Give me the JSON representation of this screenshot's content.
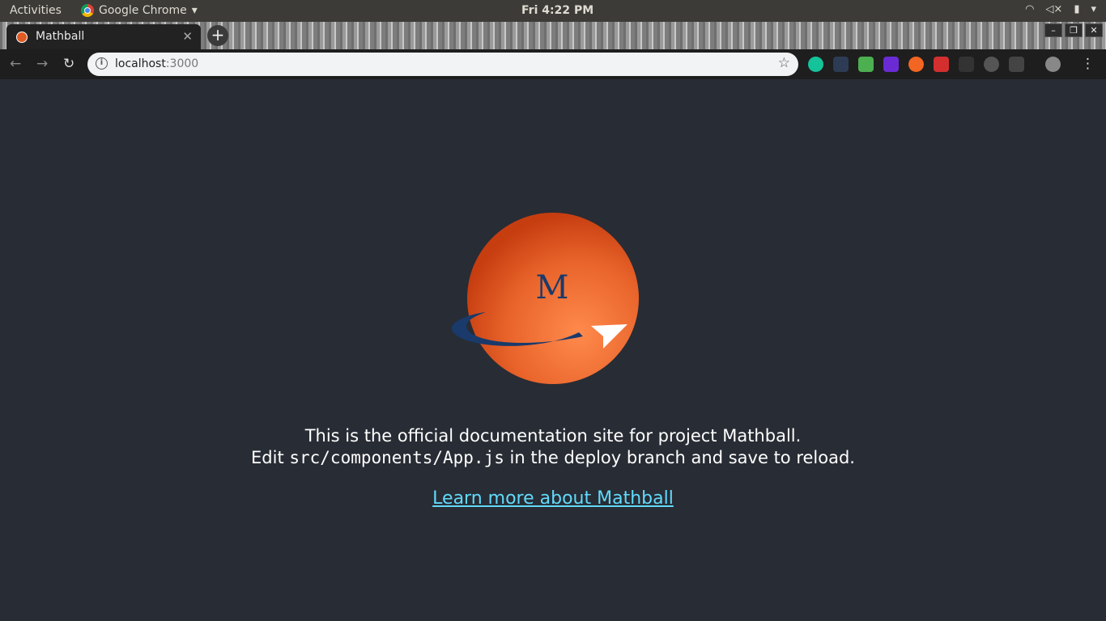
{
  "system": {
    "activities": "Activities",
    "app_name": "Google Chrome",
    "clock": "Fri  4:22 PM"
  },
  "browser": {
    "tab_title": "Mathball",
    "url_host": "localhost",
    "url_port": ":3000"
  },
  "page": {
    "logo_letter": "M",
    "line1": "This is the official documentation site for project Mathball.",
    "line2_prefix": "Edit ",
    "line2_code": "src/components/App.js",
    "line2_suffix": " in the deploy branch and save to reload.",
    "link_text": "Learn more about Mathball"
  },
  "colors": {
    "background": "#282c34",
    "link": "#61dafb",
    "ball": "#e8632a",
    "orbit": "#1a3a6b"
  }
}
